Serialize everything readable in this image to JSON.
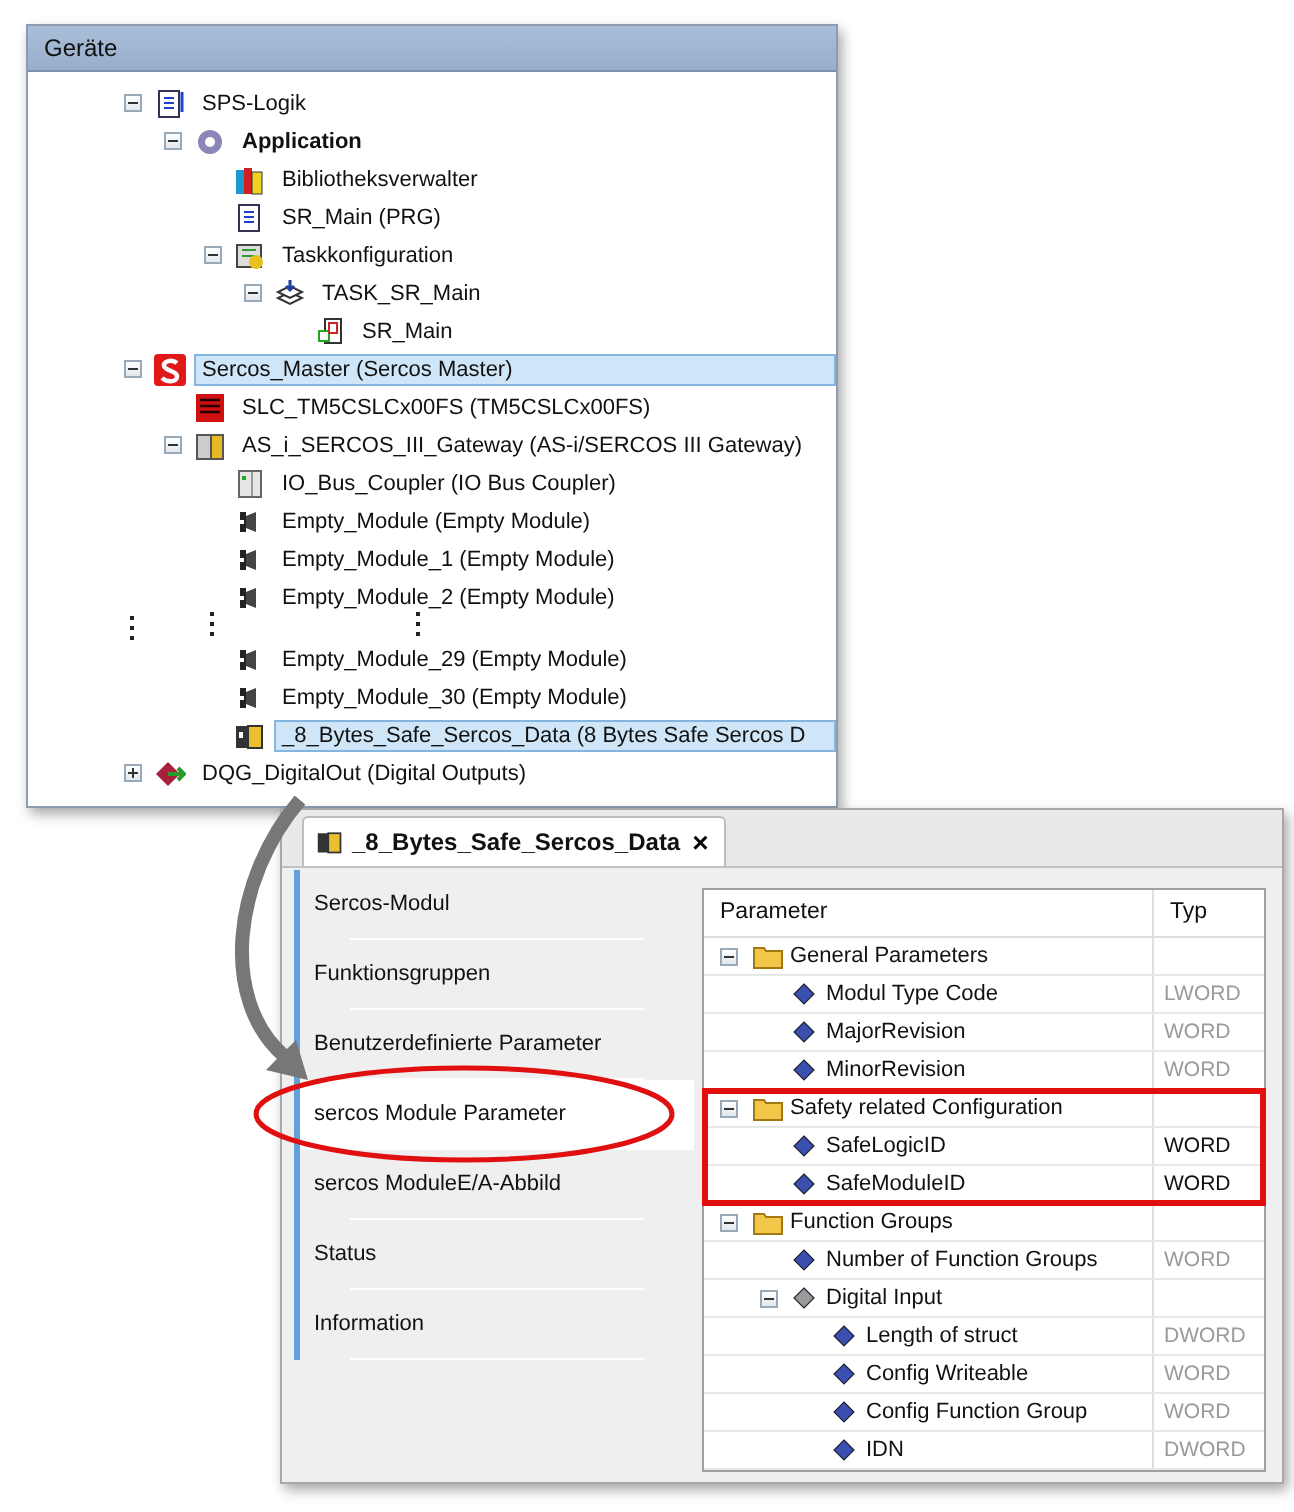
{
  "devices": {
    "title": "Geräte",
    "items": [
      {
        "kind": "plc-logic",
        "label": "SPS-Logik",
        "bold": false,
        "selected": false,
        "expanded": true,
        "children": [
          {
            "kind": "application",
            "label": "Application",
            "bold": true,
            "selected": false,
            "expanded": true,
            "children": [
              {
                "kind": "library",
                "label": "Bibliotheksverwalter",
                "bold": false,
                "selected": false
              },
              {
                "kind": "program",
                "label": "SR_Main (PRG)",
                "bold": false,
                "selected": false
              },
              {
                "kind": "task-config",
                "label": "Taskkonfiguration",
                "bold": false,
                "selected": false,
                "expanded": true,
                "children": [
                  {
                    "kind": "task",
                    "label": "TASK_SR_Main",
                    "bold": false,
                    "selected": false,
                    "expanded": true,
                    "children": [
                      {
                        "kind": "pou",
                        "label": "SR_Main",
                        "bold": false,
                        "selected": false
                      }
                    ]
                  }
                ]
              }
            ]
          }
        ]
      },
      {
        "kind": "sercos-master",
        "label": "Sercos_Master (Sercos Master)",
        "bold": false,
        "selected": true,
        "expanded": true,
        "children": [
          {
            "kind": "safety-controller",
            "label": "SLC_TM5CSLCx00FS (TM5CSLCx00FS)",
            "bold": false,
            "selected": false
          },
          {
            "kind": "gateway",
            "label": "AS_i_SERCOS_III_Gateway (AS-i/SERCOS III Gateway)",
            "bold": false,
            "selected": false,
            "expanded": true,
            "children": [
              {
                "kind": "coupler",
                "label": "IO_Bus_Coupler (IO Bus Coupler)",
                "bold": false,
                "selected": false
              },
              {
                "kind": "empty-module",
                "label": "Empty_Module (Empty Module)",
                "bold": false,
                "selected": false
              },
              {
                "kind": "empty-module",
                "label": "Empty_Module_1 (Empty Module)",
                "bold": false,
                "selected": false
              },
              {
                "kind": "empty-module",
                "label": "Empty_Module_2 (Empty Module)",
                "bold": false,
                "selected": false
              },
              {
                "kind": "gap"
              },
              {
                "kind": "empty-module",
                "label": "Empty_Module_29 (Empty Module)",
                "bold": false,
                "selected": false
              },
              {
                "kind": "empty-module",
                "label": "Empty_Module_30 (Empty Module)",
                "bold": false,
                "selected": false
              },
              {
                "kind": "safe-data",
                "label": "_8_Bytes_Safe_Sercos_Data (8 Bytes Safe Sercos D",
                "bold": false,
                "selected": true
              }
            ]
          }
        ]
      },
      {
        "kind": "digital-out",
        "label": "DQG_DigitalOut (Digital Outputs)",
        "bold": false,
        "selected": false,
        "expanded": false
      }
    ]
  },
  "editor": {
    "tab": {
      "label": "_8_Bytes_Safe_Sercos_Data",
      "close": "×"
    },
    "nav": [
      {
        "label": "Sercos-Modul",
        "selected": false
      },
      {
        "label": "Funktionsgruppen",
        "selected": false
      },
      {
        "label": "Benutzerdefinierte Parameter",
        "selected": false
      },
      {
        "label": "sercos Module Parameter",
        "selected": true
      },
      {
        "label": "sercos ModuleE/A-Abbild",
        "selected": false
      },
      {
        "label": "Status",
        "selected": false
      },
      {
        "label": "Information",
        "selected": false
      }
    ],
    "columns": [
      "Parameter",
      "Typ"
    ],
    "groups": [
      {
        "label": "General Parameters",
        "expanded": true,
        "marked": false,
        "children": [
          {
            "kind": "param",
            "label": "Modul Type Code",
            "type": "LWORD",
            "greyed": true
          },
          {
            "kind": "param",
            "label": "MajorRevision",
            "type": "WORD",
            "greyed": true
          },
          {
            "kind": "param",
            "label": "MinorRevision",
            "type": "WORD",
            "greyed": true
          }
        ]
      },
      {
        "label": "Safety related Configuration",
        "expanded": true,
        "marked": true,
        "children": [
          {
            "kind": "param",
            "label": "SafeLogicID",
            "type": "WORD",
            "greyed": false
          },
          {
            "kind": "param",
            "label": "SafeModuleID",
            "type": "WORD",
            "greyed": false
          }
        ]
      },
      {
        "label": "Function Groups",
        "expanded": true,
        "marked": false,
        "children": [
          {
            "kind": "param",
            "label": "Number of Function Groups",
            "type": "WORD",
            "greyed": true
          },
          {
            "kind": "param-group",
            "label": "Digital Input",
            "expanded": true,
            "children": [
              {
                "kind": "param",
                "label": "Length of struct",
                "type": "DWORD",
                "greyed": true
              },
              {
                "kind": "param",
                "label": "Config Writeable",
                "type": "WORD",
                "greyed": true
              },
              {
                "kind": "param",
                "label": "Config Function Group",
                "type": "WORD",
                "greyed": true
              },
              {
                "kind": "param",
                "label": "IDN",
                "type": "DWORD",
                "greyed": true
              }
            ]
          }
        ]
      }
    ]
  }
}
